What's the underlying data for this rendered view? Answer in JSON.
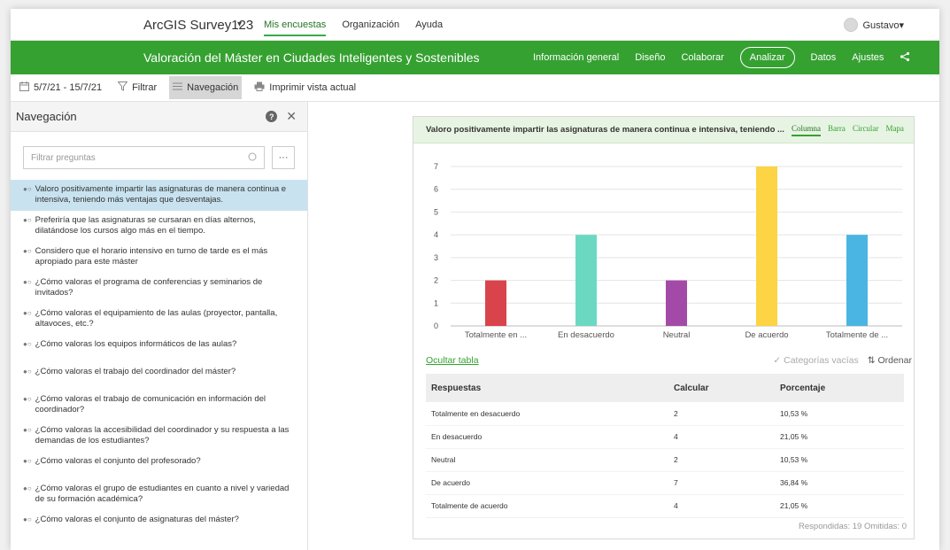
{
  "topbar": {
    "app_title": "ArcGIS Survey123",
    "caret": "▾",
    "nav": [
      "Mis encuestas",
      "Organización",
      "Ayuda"
    ],
    "user": "Gustavo▾"
  },
  "survey": {
    "title": "Valoración del Máster en Ciudades Inteligentes y Sostenibles",
    "nav": [
      "Información general",
      "Diseño",
      "Colaborar",
      "Analizar",
      "Datos",
      "Ajustes"
    ],
    "active_nav": "Analizar"
  },
  "toolbar": {
    "date_range": "5/7/21 - 15/7/21",
    "filter": "Filtrar",
    "navigation": "Navegación",
    "print": "Imprimir vista actual"
  },
  "sidebar": {
    "title": "Navegación",
    "filter_placeholder": "Filtrar preguntas",
    "more": "···",
    "questions": [
      "Valoro positivamente impartir las asignaturas de manera continua e intensiva, teniendo más ventajas que desventajas.",
      "Preferiría que las asignaturas se cursaran en días alternos, dilatándose los cursos algo más en el tiempo.",
      "Considero que el horario intensivo en turno de tarde es el más apropiado para este máster",
      "¿Cómo valoras el programa de conferencias y seminarios de invitados?",
      "¿Cómo valoras el equipamiento de las aulas (proyector, pantalla, altavoces, etc.?",
      "¿Cómo valoras los equipos informáticos de las aulas?",
      "¿Cómo valoras el trabajo del coordinador del máster?",
      "¿Cómo valoras el trabajo de comunicación en información del coordinador?",
      "¿Cómo valoras la accesibilidad del coordinador y su respuesta a las demandas de los estudiantes?",
      "¿Cómo valoras el conjunto del profesorado?",
      "¿Cómo valoras el grupo de estudiantes en cuanto a nivel y variedad de su formación académica?",
      "¿Cómo valoras el conjunto de asignaturas del máster?"
    ]
  },
  "card": {
    "title": "Valoro positivamente impartir las asignaturas de manera continua e intensiva, teniendo ...",
    "tabs": [
      "Columna",
      "Barra",
      "Circular",
      "Mapa"
    ],
    "hide_table": "Ocultar tabla",
    "empty_categories": "Categorías vacías",
    "sort": "Ordenar",
    "table_headers": [
      "Respuestas",
      "Calcular",
      "Porcentaje"
    ],
    "table_rows": [
      [
        "Totalmente en desacuerdo",
        "2",
        "10,53 %"
      ],
      [
        "En desacuerdo",
        "4",
        "21,05 %"
      ],
      [
        "Neutral",
        "2",
        "10,53 %"
      ],
      [
        "De acuerdo",
        "7",
        "36,84 %"
      ],
      [
        "Totalmente de acuerdo",
        "4",
        "21,05 %"
      ]
    ],
    "footer": "Respondidas: 19  Omitidas: 0"
  },
  "chart_data": {
    "type": "bar",
    "categories": [
      "Totalmente en ...",
      "En desacuerdo",
      "Neutral",
      "De acuerdo",
      "Totalmente de ..."
    ],
    "values": [
      2,
      4,
      2,
      7,
      4
    ],
    "colors": [
      "#d9434b",
      "#6bd8c2",
      "#a34aa8",
      "#fcd444",
      "#4ab5e2"
    ],
    "ylim": [
      0,
      7
    ],
    "yticks": [
      0,
      1,
      2,
      3,
      4,
      5,
      6,
      7
    ],
    "grid": true
  }
}
